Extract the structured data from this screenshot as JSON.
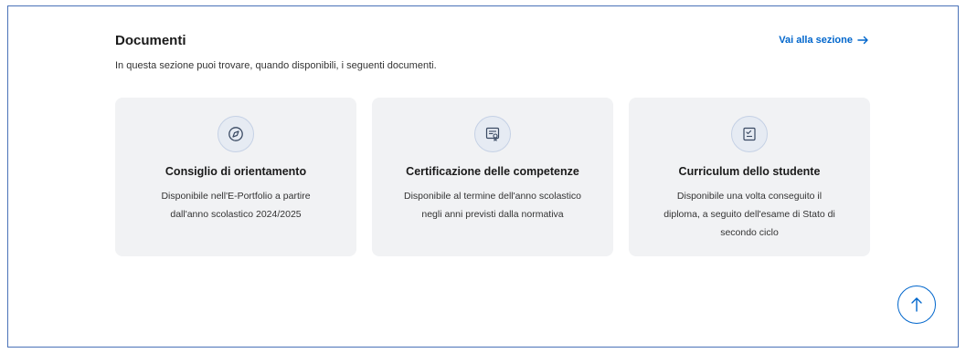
{
  "section": {
    "title": "Documenti",
    "subtitle": "In questa sezione puoi trovare, quando disponibili, i seguenti documenti.",
    "link_label": "Vai alla sezione"
  },
  "cards": [
    {
      "icon": "compass-icon",
      "title": "Consiglio di orientamento",
      "description": "Disponibile nell'E-Portfolio a partire dall'anno scolastico 2024/2025"
    },
    {
      "icon": "certificate-icon",
      "title": "Certificazione delle competenze",
      "description": "Disponibile al termine dell'anno scolastico negli anni previsti dalla normativa"
    },
    {
      "icon": "checklist-icon",
      "title": "Curriculum dello studente",
      "description": "Disponibile una volta conseguito il diploma, a seguito dell'esame di Stato di secondo ciclo"
    }
  ],
  "colors": {
    "accent": "#0066cc",
    "card_bg": "#f1f2f4",
    "border": "#4a72b8"
  },
  "scroll_top": {
    "icon": "arrow-up-icon"
  }
}
